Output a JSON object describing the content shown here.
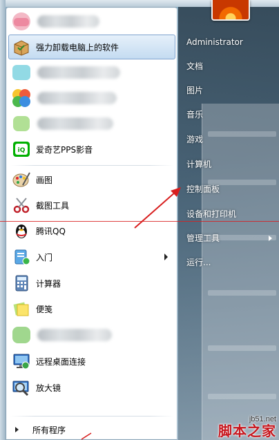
{
  "programs": [
    {
      "label": "",
      "icon": "blurred-app-icon",
      "blurred": true
    },
    {
      "label": "强力卸载电脑上的软件",
      "icon": "uninstall-box-icon",
      "selected": true
    },
    {
      "label": "",
      "icon": "blurred-app-icon",
      "blurred": true
    },
    {
      "label": "",
      "icon": "blurred-app-icon",
      "blurred": true
    },
    {
      "label": "",
      "icon": "blurred-app-icon",
      "blurred": true
    },
    {
      "label": "爱奇艺PPS影音",
      "icon": "iqiyi-icon"
    },
    {
      "label": "画图",
      "icon": "paint-palette-icon"
    },
    {
      "label": "截图工具",
      "icon": "scissors-icon"
    },
    {
      "label": "腾讯QQ",
      "icon": "qq-penguin-icon"
    },
    {
      "label": "入门",
      "icon": "getting-started-icon",
      "submenu": true
    },
    {
      "label": "计算器",
      "icon": "calculator-icon"
    },
    {
      "label": "便笺",
      "icon": "sticky-note-icon"
    },
    {
      "label": "",
      "icon": "blurred-app-icon",
      "blurred": true
    },
    {
      "label": "远程桌面连接",
      "icon": "remote-desktop-icon"
    },
    {
      "label": "放大镜",
      "icon": "magnifier-icon"
    }
  ],
  "all_programs": {
    "label": "所有程序"
  },
  "right_menu": {
    "username": "Administrator",
    "items": [
      {
        "label": "文档"
      },
      {
        "label": "图片"
      },
      {
        "label": "音乐"
      },
      {
        "label": "游戏"
      },
      {
        "label": "计算机"
      },
      {
        "label": "控制面板"
      },
      {
        "label": "设备和打印机"
      },
      {
        "label": "管理工具",
        "submenu": true
      },
      {
        "label": "运行..."
      }
    ]
  },
  "watermark": {
    "site": "jb51.net",
    "name": "脚本之家"
  },
  "colors": {
    "annotation": "#d81e1e",
    "selected_bg": "#c4dbf1"
  }
}
